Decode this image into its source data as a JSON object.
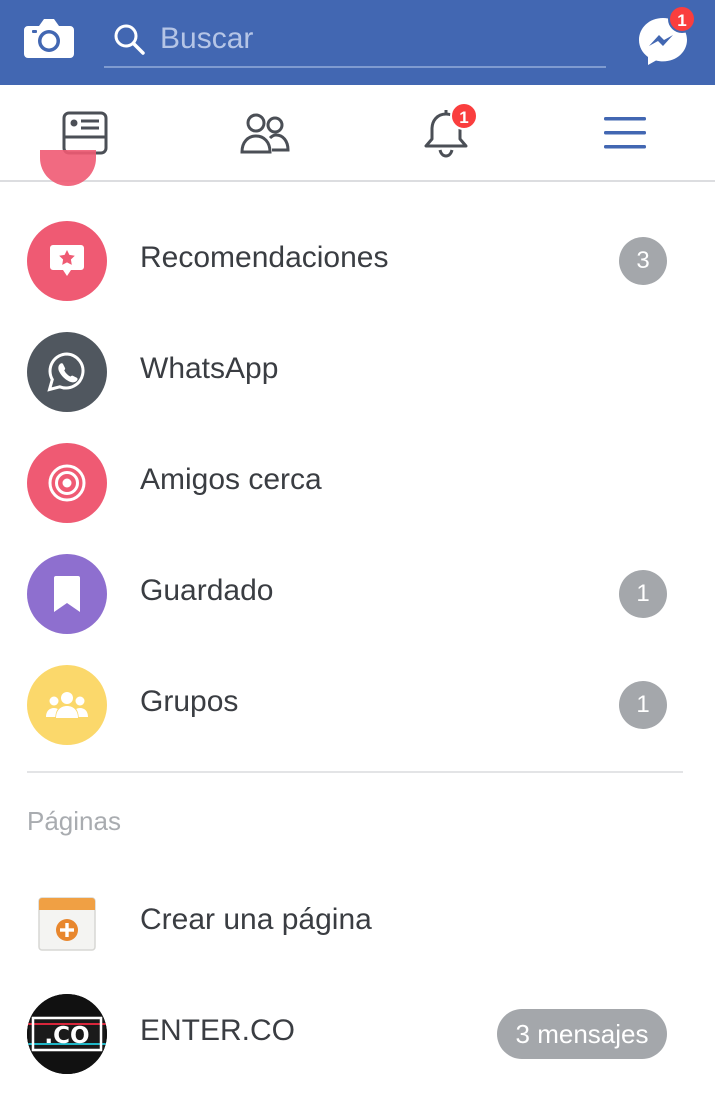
{
  "search": {
    "placeholder": "Buscar"
  },
  "header": {
    "messenger_badge": "1"
  },
  "nav": {
    "notifications_badge": "1"
  },
  "menu_items": [
    {
      "label": "Recomendaciones",
      "count": "3",
      "icon": "recommendation-star-icon",
      "color": "#ef5a73"
    },
    {
      "label": "WhatsApp",
      "count": "",
      "icon": "whatsapp-icon",
      "color": "#50575f"
    },
    {
      "label": "Amigos cerca",
      "count": "",
      "icon": "target-icon",
      "color": "#ef5a73"
    },
    {
      "label": "Guardado",
      "count": "1",
      "icon": "bookmark-icon",
      "color": "#8e6fcf"
    },
    {
      "label": "Grupos",
      "count": "1",
      "icon": "groups-icon",
      "color": "#fbd86b"
    }
  ],
  "pages_section": {
    "title": "Páginas",
    "create_label": "Crear una página",
    "enter_label": "ENTER.CO",
    "enter_logo_text": ".CO",
    "enter_badge": "3 mensajes"
  },
  "colors": {
    "brand": "#4267b2",
    "nav_icon": "#4b4f56",
    "active": "#4267b2",
    "badge": "#fa3e3e"
  }
}
